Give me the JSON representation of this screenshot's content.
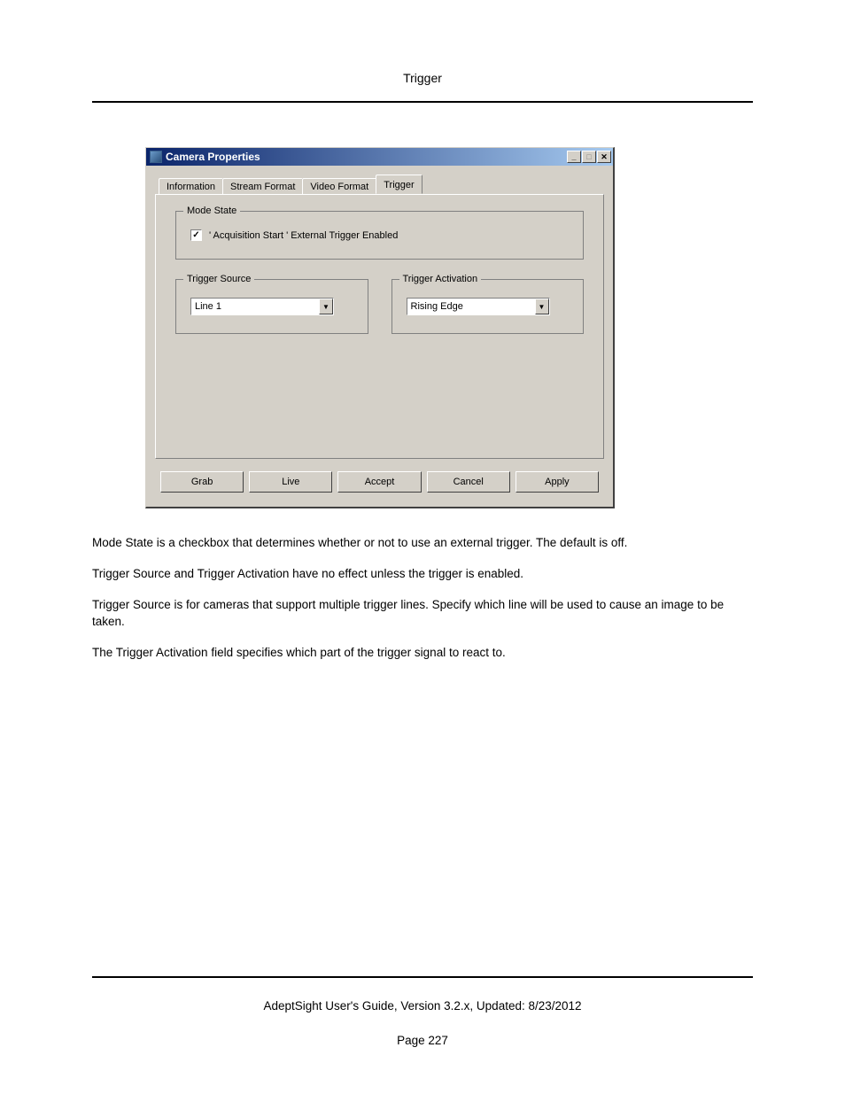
{
  "page": {
    "header_title": "Trigger",
    "footer_line": "AdeptSight User's Guide,  Version 3.2.x, Updated: 8/23/2012",
    "page_number": "Page 227"
  },
  "dialog": {
    "title": "Camera Properties",
    "tabs": {
      "information": "Information",
      "stream_format": "Stream Format",
      "video_format": "Video Format",
      "trigger": "Trigger"
    },
    "group_mode_state": "Mode State",
    "checkbox_label": " ' Acquisition Start ' External Trigger Enabled",
    "checkbox_mark": "✓",
    "group_trigger_source": "Trigger Source",
    "trigger_source_value": "Line 1",
    "group_trigger_activation": "Trigger Activation",
    "trigger_activation_value": "Rising Edge",
    "dropdown_arrow": "▼",
    "buttons": {
      "grab": "Grab",
      "live": "Live",
      "accept": "Accept",
      "cancel": "Cancel",
      "apply": "Apply"
    },
    "win_controls": {
      "minimize": "_",
      "maximize": "□",
      "close": "✕"
    }
  },
  "body": {
    "p1": "Mode State is a checkbox that determines whether or not to use an external trigger. The default is off.",
    "p2": "Trigger Source and Trigger Activation have no effect unless the trigger is enabled.",
    "p3": "Trigger Source is for cameras that support multiple trigger lines. Specify which line will be used to cause an image to be taken.",
    "p4": "The Trigger Activation field specifies which part of the trigger signal to react to."
  }
}
